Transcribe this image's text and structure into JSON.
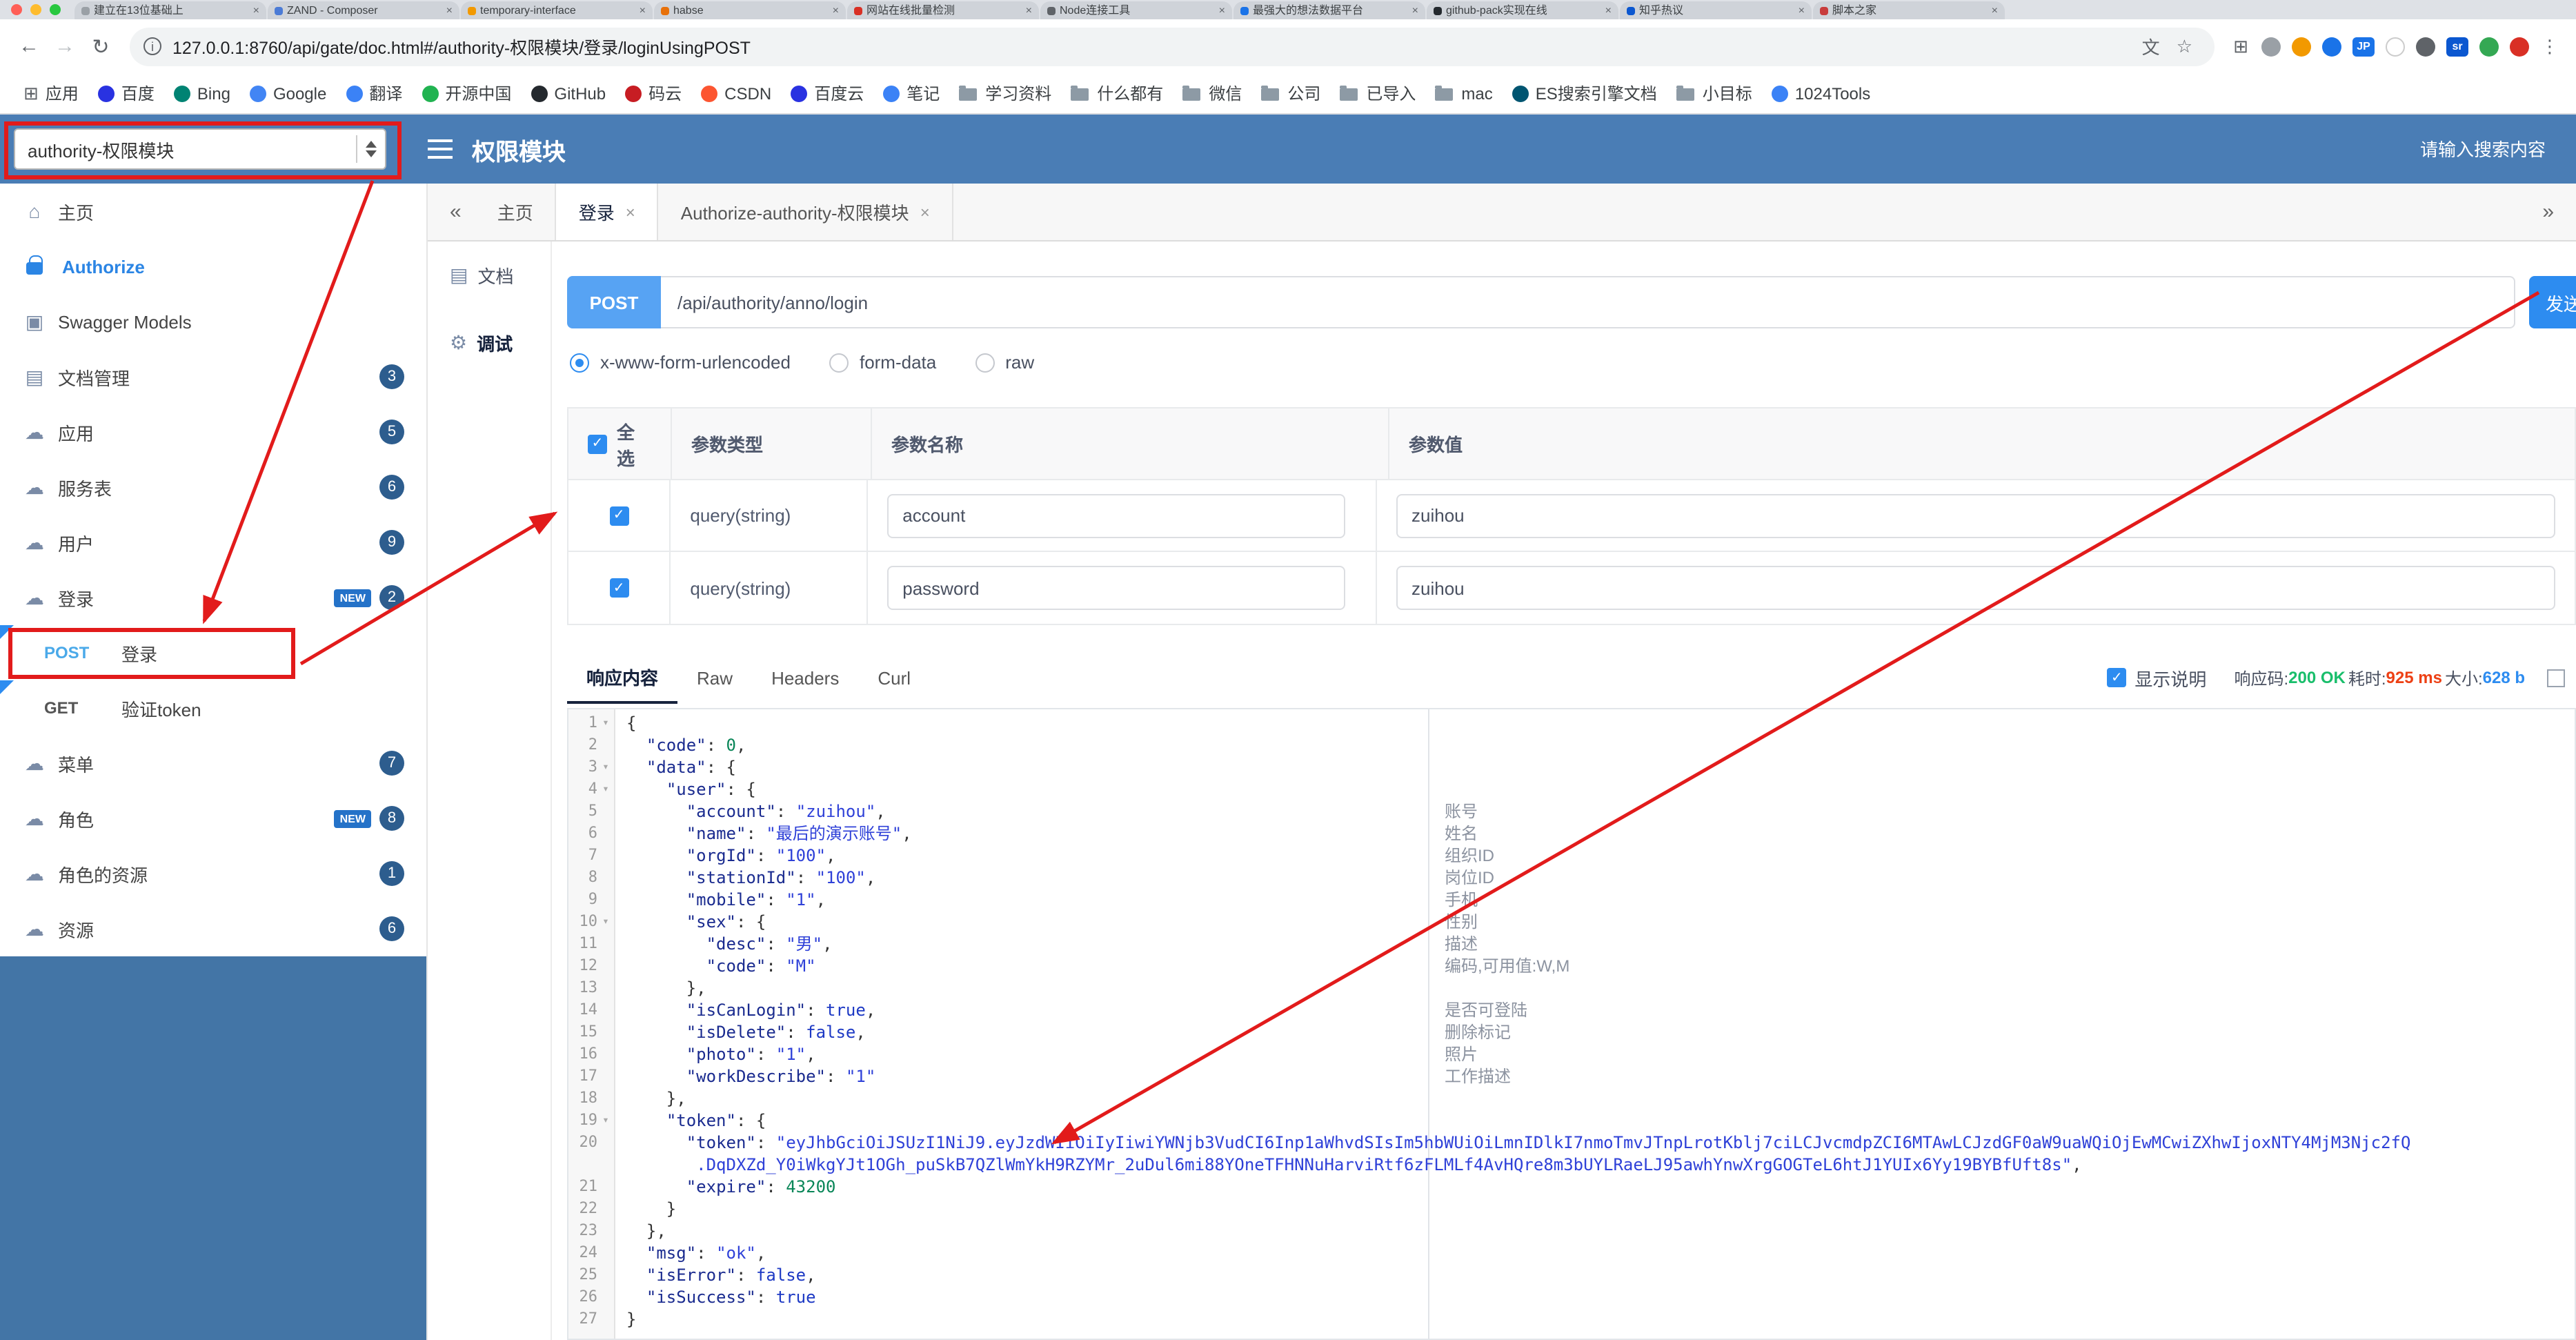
{
  "colors": {
    "header_blue": "#4a7db5",
    "sidebar_blue": "#4375a6",
    "badge_blue": "#2d5d8e",
    "primary": "#2d8cf0",
    "annotation_red": "#e21b1b"
  },
  "browser": {
    "tabs": [
      {
        "label": "建立在13位基础上",
        "favicon": "#9aa0a6"
      },
      {
        "label": "ZAND - Composer",
        "favicon": "#4b7bd6"
      },
      {
        "label": "temporary-interface",
        "favicon": "#f29900"
      },
      {
        "label": "habse",
        "favicon": "#e8710a"
      },
      {
        "label": "网站在线批量检测",
        "favicon": "#d93025"
      },
      {
        "label": "Node连接工具",
        "favicon": "#5f6368"
      },
      {
        "label": "最强大的想法数据平台",
        "favicon": "#1a73e8"
      },
      {
        "label": "github-pack实现在线",
        "favicon": "#24292e"
      },
      {
        "label": "知乎热议",
        "favicon": "#0b57d0"
      },
      {
        "label": "脚本之家",
        "favicon": "#c83c3c"
      }
    ],
    "address": {
      "url": "127.0.0.1:8760/api/gate/doc.html#/authority-权限模块/登录/loginUsingPOST"
    },
    "action_icons": [
      {
        "name": "extensions-icon",
        "type": "glyph",
        "glyph": "⊞",
        "color": "#5f6368"
      },
      {
        "name": "info-extension-icon",
        "type": "dot",
        "color": "#9aa0a6"
      },
      {
        "name": "orange-extension-icon",
        "type": "dot",
        "color": "#f29900"
      },
      {
        "name": "blue-extension-icon",
        "type": "dot",
        "color": "#1a73e8"
      },
      {
        "name": "jp-extension-icon",
        "type": "badge",
        "color": "#1a73e8",
        "text": "JP"
      },
      {
        "name": "white-extension-icon",
        "type": "dot",
        "color": "#ffffff",
        "border": true
      },
      {
        "name": "shield-extension-icon",
        "type": "dot",
        "color": "#5f6368"
      },
      {
        "name": "sr-extension-icon",
        "type": "badge",
        "color": "#0b57d0",
        "text": "sr"
      },
      {
        "name": "green-extension-icon",
        "type": "dot",
        "color": "#34a853"
      },
      {
        "name": "profile-avatar",
        "type": "dot",
        "color": "#d93025"
      },
      {
        "name": "more-vert-icon",
        "type": "glyph",
        "glyph": "⋮",
        "color": "#5f6368"
      }
    ],
    "bookmarks": [
      {
        "label": "应用",
        "icon": "grid"
      },
      {
        "label": "百度",
        "icon": "dot",
        "color": "#2932e1"
      },
      {
        "label": "Bing",
        "icon": "dot",
        "color": "#008373"
      },
      {
        "label": "Google",
        "icon": "dot",
        "color": "#4285f4"
      },
      {
        "label": "翻译",
        "icon": "dot",
        "color": "#3b82f6"
      },
      {
        "label": "开源中国",
        "icon": "dot",
        "color": "#21b351"
      },
      {
        "label": "GitHub",
        "icon": "dot",
        "color": "#24292e"
      },
      {
        "label": "码云",
        "icon": "dot",
        "color": "#c71d23"
      },
      {
        "label": "CSDN",
        "icon": "dot",
        "color": "#fc5531"
      },
      {
        "label": "百度云",
        "icon": "dot",
        "color": "#2932e1"
      },
      {
        "label": "笔记",
        "icon": "dot",
        "color": "#3b82f6"
      },
      {
        "label": "学习资料",
        "icon": "folder"
      },
      {
        "label": "什么都有",
        "icon": "folder"
      },
      {
        "label": "微信",
        "icon": "folder"
      },
      {
        "label": "公司",
        "icon": "folder"
      },
      {
        "label": "已导入",
        "icon": "folder"
      },
      {
        "label": "mac",
        "icon": "folder"
      },
      {
        "label": "ES搜索引擎文档",
        "icon": "dot",
        "color": "#005571"
      },
      {
        "label": "小目标",
        "icon": "folder"
      },
      {
        "label": "1024Tools",
        "icon": "dot",
        "color": "#3b82f6"
      }
    ]
  },
  "app_header": {
    "module_select": "authority-权限模块",
    "title": "权限模块",
    "search_placeholder": "请输入搜索内容"
  },
  "sidebar": {
    "icon_glyphs": {
      "home": "⌂",
      "models": "▣",
      "docs": "▤",
      "cloud": "☁"
    },
    "items": [
      {
        "key": "home",
        "label": "主页",
        "icon": "home"
      },
      {
        "key": "authorize",
        "label": "Authorize",
        "icon": "lock",
        "accent": true
      },
      {
        "key": "swagger-models",
        "label": "Swagger Models",
        "icon": "models"
      },
      {
        "key": "docs",
        "label": "文档管理",
        "icon": "docs",
        "badge": "3"
      },
      {
        "key": "app",
        "label": "应用",
        "icon": "cloud",
        "badge": "5"
      },
      {
        "key": "service",
        "label": "服务表",
        "icon": "cloud",
        "badge": "6"
      },
      {
        "key": "user",
        "label": "用户",
        "icon": "cloud",
        "badge": "9"
      },
      {
        "key": "login",
        "label": "登录",
        "icon": "cloud",
        "badge": "2",
        "new": true
      },
      {
        "key": "login-post",
        "label": "登录",
        "method": "POST",
        "changed": true
      },
      {
        "key": "verify-token-get",
        "label": "验证token",
        "method": "GET",
        "changed": true
      },
      {
        "key": "menu",
        "label": "菜单",
        "icon": "cloud",
        "badge": "7"
      },
      {
        "key": "role",
        "label": "角色",
        "icon": "cloud",
        "badge": "8",
        "new": true
      },
      {
        "key": "role-resource",
        "label": "角色的资源",
        "icon": "cloud",
        "badge": "1"
      },
      {
        "key": "resource",
        "label": "资源",
        "icon": "cloud",
        "badge": "6"
      }
    ]
  },
  "page_tabs": {
    "collapse_icon": "«",
    "expand_icon": "»",
    "items": [
      {
        "key": "home",
        "label": "主页",
        "closable": false
      },
      {
        "key": "login",
        "label": "登录",
        "closable": true,
        "active": true
      },
      {
        "key": "authorize",
        "label": "Authorize-authority-权限模块",
        "closable": true
      }
    ]
  },
  "doc_side_tabs": [
    {
      "key": "doc",
      "label": "文档",
      "icon": "doc"
    },
    {
      "key": "debug",
      "label": "调试",
      "icon": "debug",
      "active": true
    }
  ],
  "request": {
    "method": "POST",
    "url": "/api/authority/anno/login",
    "send_label": "发送",
    "content_types": [
      {
        "label": "x-www-form-urlencoded",
        "selected": true
      },
      {
        "label": "form-data",
        "selected": false
      },
      {
        "label": "raw",
        "selected": false
      }
    ]
  },
  "params_table": {
    "select_all_label": "全选",
    "columns": [
      "参数类型",
      "参数名称",
      "参数值"
    ],
    "rows": [
      {
        "checked": true,
        "type": "query(string)",
        "name": "account",
        "value": "zuihou"
      },
      {
        "checked": true,
        "type": "query(string)",
        "name": "password",
        "value": "zuihou"
      }
    ]
  },
  "response": {
    "tabs": [
      {
        "key": "content",
        "label": "响应内容",
        "active": true
      },
      {
        "key": "raw",
        "label": "Raw"
      },
      {
        "key": "headers",
        "label": "Headers"
      },
      {
        "key": "curl",
        "label": "Curl"
      }
    ],
    "show_desc_label": "显示说明",
    "meta": [
      {
        "label": "响应码:",
        "value": "200 OK",
        "color": "#19be6b"
      },
      {
        "label": "耗时:",
        "value": "925 ms",
        "color": "#ed4014"
      },
      {
        "label": "大小:",
        "value": "628 b",
        "color": "#2d8cf0"
      }
    ]
  },
  "editor": {
    "lines": [
      {
        "n": 1,
        "f": true,
        "t": [
          [
            "p",
            "{"
          ]
        ]
      },
      {
        "n": 2,
        "t": [
          [
            "p",
            "  "
          ],
          [
            "k",
            "\"code\""
          ],
          [
            "p",
            ": "
          ],
          [
            "n",
            "0"
          ],
          [
            "p",
            ","
          ]
        ]
      },
      {
        "n": 3,
        "f": true,
        "t": [
          [
            "p",
            "  "
          ],
          [
            "k",
            "\"data\""
          ],
          [
            "p",
            ": {"
          ]
        ]
      },
      {
        "n": 4,
        "f": true,
        "t": [
          [
            "p",
            "    "
          ],
          [
            "k",
            "\"user\""
          ],
          [
            "p",
            ": {"
          ]
        ]
      },
      {
        "n": 5,
        "t": [
          [
            "p",
            "      "
          ],
          [
            "k",
            "\"account\""
          ],
          [
            "p",
            ": "
          ],
          [
            "s",
            "\"zuihou\""
          ],
          [
            "p",
            ","
          ]
        ]
      },
      {
        "n": 6,
        "t": [
          [
            "p",
            "      "
          ],
          [
            "k",
            "\"name\""
          ],
          [
            "p",
            ": "
          ],
          [
            "s",
            "\"最后的演示账号\""
          ],
          [
            "p",
            ","
          ]
        ]
      },
      {
        "n": 7,
        "t": [
          [
            "p",
            "      "
          ],
          [
            "k",
            "\"orgId\""
          ],
          [
            "p",
            ": "
          ],
          [
            "s",
            "\"100\""
          ],
          [
            "p",
            ","
          ]
        ]
      },
      {
        "n": 8,
        "t": [
          [
            "p",
            "      "
          ],
          [
            "k",
            "\"stationId\""
          ],
          [
            "p",
            ": "
          ],
          [
            "s",
            "\"100\""
          ],
          [
            "p",
            ","
          ]
        ]
      },
      {
        "n": 9,
        "t": [
          [
            "p",
            "      "
          ],
          [
            "k",
            "\"mobile\""
          ],
          [
            "p",
            ": "
          ],
          [
            "s",
            "\"1\""
          ],
          [
            "p",
            ","
          ]
        ]
      },
      {
        "n": 10,
        "f": true,
        "t": [
          [
            "p",
            "      "
          ],
          [
            "k",
            "\"sex\""
          ],
          [
            "p",
            ": {"
          ]
        ]
      },
      {
        "n": 11,
        "t": [
          [
            "p",
            "        "
          ],
          [
            "k",
            "\"desc\""
          ],
          [
            "p",
            ": "
          ],
          [
            "s",
            "\"男\""
          ],
          [
            "p",
            ","
          ]
        ]
      },
      {
        "n": 12,
        "t": [
          [
            "p",
            "        "
          ],
          [
            "k",
            "\"code\""
          ],
          [
            "p",
            ": "
          ],
          [
            "s",
            "\"M\""
          ]
        ]
      },
      {
        "n": 13,
        "t": [
          [
            "p",
            "      },"
          ]
        ]
      },
      {
        "n": 14,
        "t": [
          [
            "p",
            "      "
          ],
          [
            "k",
            "\"isCanLogin\""
          ],
          [
            "p",
            ": "
          ],
          [
            "b",
            "true"
          ],
          [
            "p",
            ","
          ]
        ]
      },
      {
        "n": 15,
        "t": [
          [
            "p",
            "      "
          ],
          [
            "k",
            "\"isDelete\""
          ],
          [
            "p",
            ": "
          ],
          [
            "b",
            "false"
          ],
          [
            "p",
            ","
          ]
        ]
      },
      {
        "n": 16,
        "t": [
          [
            "p",
            "      "
          ],
          [
            "k",
            "\"photo\""
          ],
          [
            "p",
            ": "
          ],
          [
            "s",
            "\"1\""
          ],
          [
            "p",
            ","
          ]
        ]
      },
      {
        "n": 17,
        "t": [
          [
            "p",
            "      "
          ],
          [
            "k",
            "\"workDescribe\""
          ],
          [
            "p",
            ": "
          ],
          [
            "s",
            "\"1\""
          ]
        ]
      },
      {
        "n": 18,
        "t": [
          [
            "p",
            "    },"
          ]
        ]
      },
      {
        "n": 19,
        "f": true,
        "t": [
          [
            "p",
            "    "
          ],
          [
            "k",
            "\"token\""
          ],
          [
            "p",
            ": {"
          ]
        ]
      },
      {
        "n": 20,
        "t": [
          [
            "p",
            "      "
          ],
          [
            "k",
            "\"token\""
          ],
          [
            "p",
            ": "
          ],
          [
            "s",
            "\"eyJhbGciOiJSUzI1NiJ9.eyJzdWIiOiIyIiwiYWNjb3VudCI6Inp1aWhvdSIsIm5hbWUiOiLmnIDlkI7nmoTmvJTnpLrotKblj7ciLCJvcmdpZCI6MTAwLCJzdGF0aW9uaWQiOjEwMCwiZXhwIjoxNTY4MjM3Njc2fQ"
          ],
          [
            "w",
            ""
          ],
          [
            "s",
            "       .DqDXZd_Y0iWkgYJt1OGh_puSkB7QZlWmYkH9RZYMr_2uDul6mi88YOneTFHNNuHarviRtf6zFLMLf4AvHQre8m3bUYLRaeLJ95awhYnwXrgGOGTeL6htJ1YUIx6Yy19BYBfUft8s\""
          ],
          [
            "p",
            ","
          ]
        ]
      },
      {
        "n": 21,
        "t": [
          [
            "p",
            "      "
          ],
          [
            "k",
            "\"expire\""
          ],
          [
            "p",
            ": "
          ],
          [
            "n",
            "43200"
          ]
        ]
      },
      {
        "n": 22,
        "t": [
          [
            "p",
            "    }"
          ]
        ]
      },
      {
        "n": 23,
        "t": [
          [
            "p",
            "  },"
          ]
        ]
      },
      {
        "n": 24,
        "t": [
          [
            "p",
            "  "
          ],
          [
            "k",
            "\"msg\""
          ],
          [
            "p",
            ": "
          ],
          [
            "s",
            "\"ok\""
          ],
          [
            "p",
            ","
          ]
        ]
      },
      {
        "n": 25,
        "t": [
          [
            "p",
            "  "
          ],
          [
            "k",
            "\"isError\""
          ],
          [
            "p",
            ": "
          ],
          [
            "b",
            "false"
          ],
          [
            "p",
            ","
          ]
        ]
      },
      {
        "n": 26,
        "t": [
          [
            "p",
            "  "
          ],
          [
            "k",
            "\"isSuccess\""
          ],
          [
            "p",
            ": "
          ],
          [
            "b",
            "true"
          ]
        ]
      },
      {
        "n": 27,
        "t": [
          [
            "p",
            "}"
          ]
        ]
      }
    ],
    "notes": [
      {
        "line": 5,
        "text": "账号"
      },
      {
        "line": 6,
        "text": "姓名"
      },
      {
        "line": 7,
        "text": "组织ID"
      },
      {
        "line": 8,
        "text": "岗位ID"
      },
      {
        "line": 9,
        "text": "手机"
      },
      {
        "line": 10,
        "text": "性别"
      },
      {
        "line": 11,
        "text": "描述"
      },
      {
        "line": 12,
        "text": "编码,可用值:W,M"
      },
      {
        "line": 14,
        "text": "是否可登陆"
      },
      {
        "line": 15,
        "text": "删除标记"
      },
      {
        "line": 16,
        "text": "照片"
      },
      {
        "line": 17,
        "text": "工作描述"
      }
    ]
  }
}
